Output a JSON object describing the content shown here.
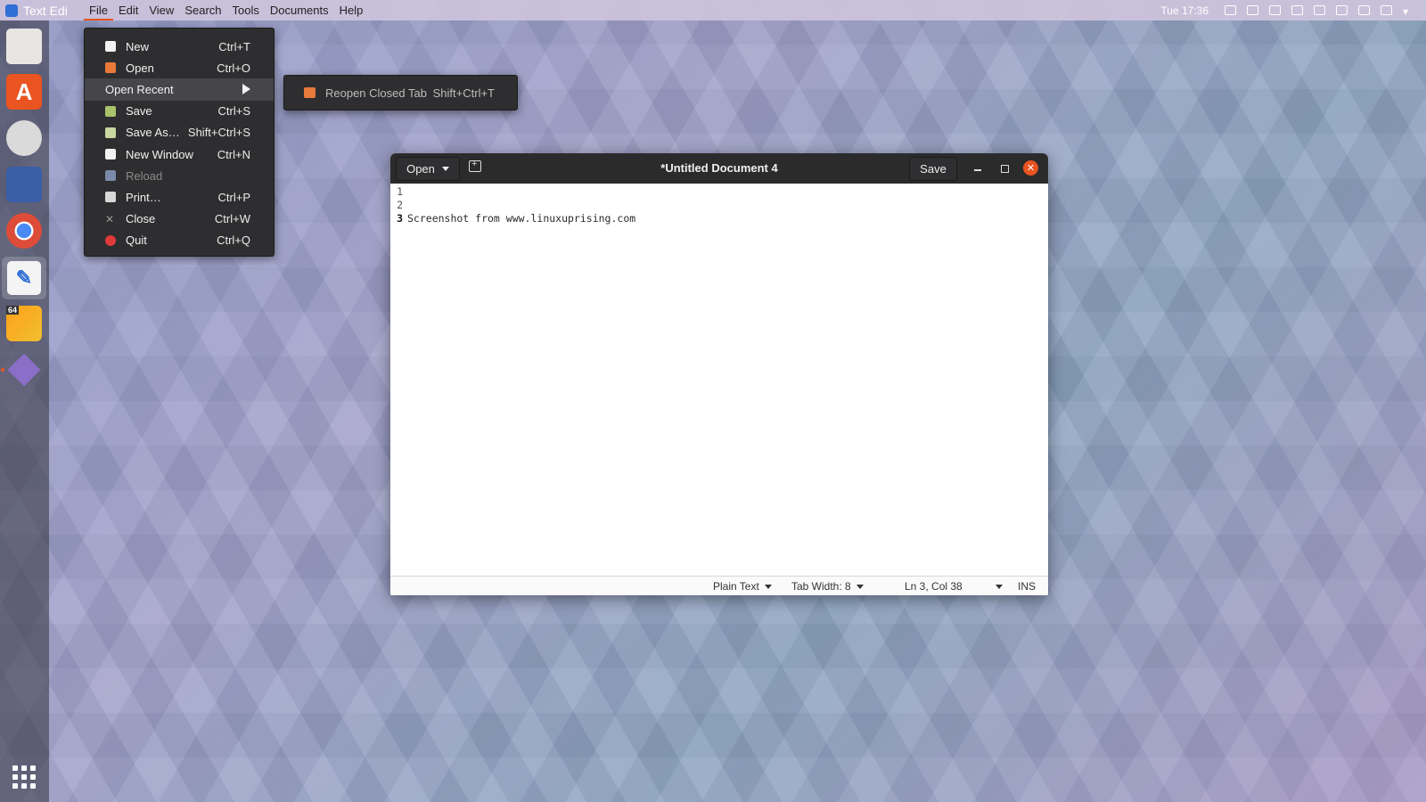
{
  "topbar": {
    "app_name": "Text Edi",
    "menus": [
      "File",
      "Edit",
      "View",
      "Search",
      "Tools",
      "Documents",
      "Help"
    ],
    "clock": "Tue 17:36"
  },
  "file_menu": {
    "items": [
      {
        "label": "New",
        "shortcut": "Ctrl+T"
      },
      {
        "label": "Open",
        "shortcut": "Ctrl+O"
      },
      {
        "label": "Open Recent",
        "shortcut": ""
      },
      {
        "label": "Save",
        "shortcut": "Ctrl+S"
      },
      {
        "label": "Save As…",
        "shortcut": "Shift+Ctrl+S"
      },
      {
        "label": "New Window",
        "shortcut": "Ctrl+N"
      },
      {
        "label": "Reload",
        "shortcut": ""
      },
      {
        "label": "Print…",
        "shortcut": "Ctrl+P"
      },
      {
        "label": "Close",
        "shortcut": "Ctrl+W"
      },
      {
        "label": "Quit",
        "shortcut": "Ctrl+Q"
      }
    ]
  },
  "submenu": {
    "label": "Reopen Closed Tab",
    "shortcut": "Shift+Ctrl+T"
  },
  "window": {
    "open_label": "Open",
    "title": "*Untitled Document 4",
    "save_label": "Save",
    "close_glyph": "✕"
  },
  "editor": {
    "lines": [
      {
        "num": "1",
        "text": ""
      },
      {
        "num": "2",
        "text": ""
      },
      {
        "num": "3",
        "text": "Screenshot from www.linuxuprising.com"
      }
    ]
  },
  "statusbar": {
    "language": "Plain Text",
    "tab_width": "Tab Width: 8",
    "position": "Ln 3, Col 38",
    "mode": "INS"
  },
  "dock": {
    "badge": "64"
  },
  "colors": {
    "accent": "#e95420",
    "menu_bg": "#2e2e30",
    "headerbar_bg": "#2b2b2c"
  }
}
